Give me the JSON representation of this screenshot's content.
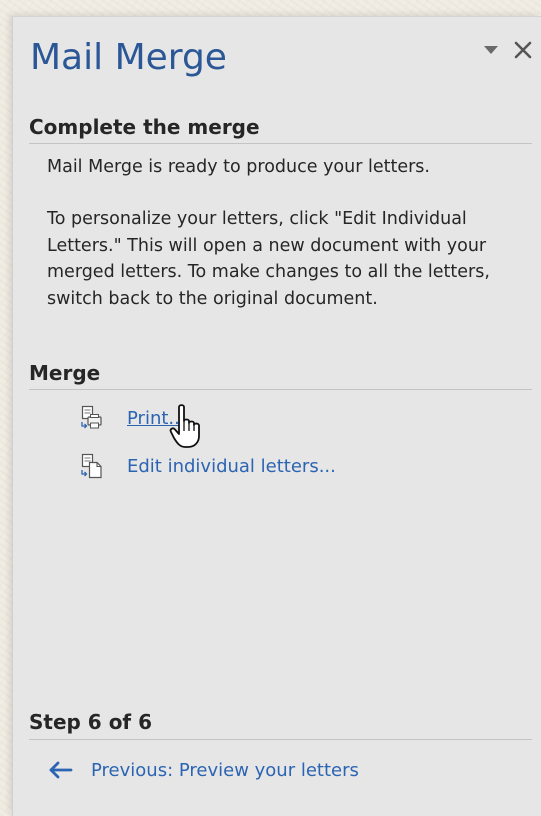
{
  "pane": {
    "title": "Mail Merge"
  },
  "complete": {
    "heading": "Complete the merge",
    "ready_text": "Mail Merge is ready to produce your letters.",
    "instructions_text": "To personalize your letters, click \"Edit Individual Letters.\" This will open a new document with your merged letters. To make changes to all the letters, switch back to the original document."
  },
  "merge": {
    "heading": "Merge",
    "print_label": "Print...",
    "edit_label": "Edit individual letters..."
  },
  "step": {
    "heading": "Step 6 of 6",
    "previous_label": "Previous: Preview your letters"
  },
  "colors": {
    "accent": "#2b5797",
    "link": "#2b64b3",
    "pane_background": "#e6e6e6"
  }
}
